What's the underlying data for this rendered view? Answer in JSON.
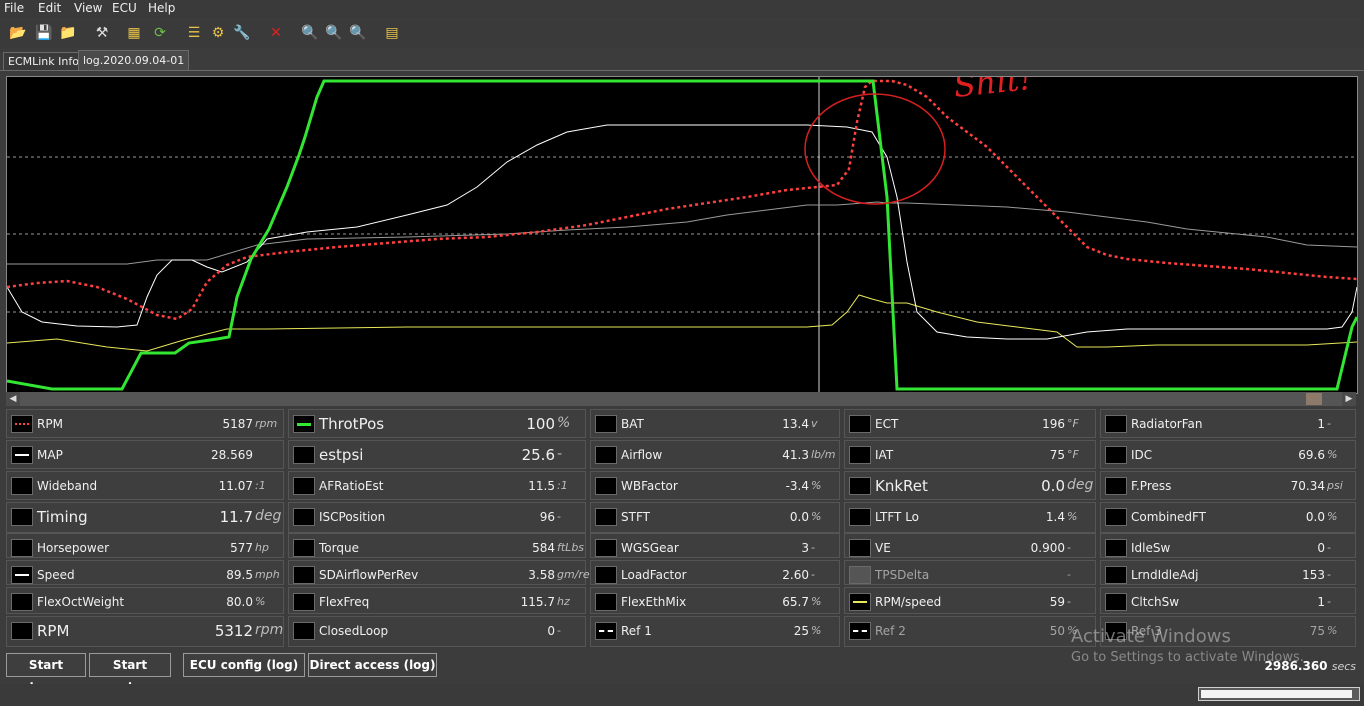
{
  "menu": [
    "File",
    "Edit",
    "View",
    "ECU",
    "Help"
  ],
  "toolbar_icons": [
    "open-folder-icon",
    "save-icon",
    "folder-icon",
    "tools-icon",
    "chart-settings-icon",
    "refresh-icon",
    "list-icon",
    "config-icon",
    "wrench-icon",
    "close-red-icon",
    "zoom-reset-icon",
    "zoom-in-icon",
    "zoom-out-icon",
    "report-icon"
  ],
  "tabs": [
    "ECMLink Info",
    "log.2020.09.04-01"
  ],
  "annotation_text": "Shit!",
  "colors": {
    "rpm": "#ff4040",
    "throttle": "#33e633",
    "map": "#ffffff",
    "speed": "#ffffff",
    "rpm_speed": "#e8e85a",
    "ref": "#ffffff",
    "background": "#000000"
  },
  "params": [
    [
      {
        "name": "RPM",
        "value": "5187",
        "unit": "rpm",
        "swatch": "red-dotted"
      },
      {
        "name": "MAP",
        "value": "28.569",
        "unit": "",
        "swatch": "white"
      },
      {
        "name": "Wideband",
        "value": "11.07",
        "unit": ":1"
      },
      {
        "name": "Timing",
        "value": "11.7",
        "unit": "deg",
        "big": true
      },
      {
        "name": "Horsepower",
        "value": "577",
        "unit": "hp"
      },
      {
        "name": "Speed",
        "value": "89.5",
        "unit": "mph",
        "swatch": "white"
      },
      {
        "name": "FlexOctWeight",
        "value": "80.0",
        "unit": "%"
      },
      {
        "name": "RPM",
        "value": "5312",
        "unit": "rpm",
        "big": true
      }
    ],
    [
      {
        "name": "ThrotPos",
        "value": "100",
        "unit": "%",
        "swatch": "green",
        "big": true
      },
      {
        "name": "estpsi",
        "value": "25.6",
        "unit": "-",
        "big": true
      },
      {
        "name": "AFRatioEst",
        "value": "11.5",
        "unit": ":1"
      },
      {
        "name": "ISCPosition",
        "value": "96",
        "unit": "-"
      },
      {
        "name": "Torque",
        "value": "584",
        "unit": "ftLbs"
      },
      {
        "name": "SDAirflowPerRev",
        "value": "3.58",
        "unit": "gm/rev"
      },
      {
        "name": "FlexFreq",
        "value": "115.7",
        "unit": "hz"
      },
      {
        "name": "ClosedLoop",
        "value": "0",
        "unit": "-"
      }
    ],
    [
      {
        "name": "BAT",
        "value": "13.4",
        "unit": "v"
      },
      {
        "name": "Airflow",
        "value": "41.3",
        "unit": "lb/m"
      },
      {
        "name": "WBFactor",
        "value": "-3.4",
        "unit": "%"
      },
      {
        "name": "STFT",
        "value": "0.0",
        "unit": "%"
      },
      {
        "name": "WGSGear",
        "value": "3",
        "unit": "-"
      },
      {
        "name": "LoadFactor",
        "value": "2.60",
        "unit": "-"
      },
      {
        "name": "FlexEthMix",
        "value": "65.7",
        "unit": "%"
      },
      {
        "name": "Ref 1",
        "value": "25",
        "unit": "%",
        "swatch": "white-dashed"
      }
    ],
    [
      {
        "name": "ECT",
        "value": "196",
        "unit": "°F"
      },
      {
        "name": "IAT",
        "value": "75",
        "unit": "°F"
      },
      {
        "name": "KnkRet",
        "value": "0.0",
        "unit": "deg",
        "big": true
      },
      {
        "name": "LTFT Lo",
        "value": "1.4",
        "unit": "%"
      },
      {
        "name": "VE",
        "value": "0.900",
        "unit": "-"
      },
      {
        "name": "TPSDelta",
        "value": "",
        "unit": "-",
        "dim": true,
        "swatch": "grey"
      },
      {
        "name": "RPM/speed",
        "value": "59",
        "unit": "-",
        "swatch": "yellow"
      },
      {
        "name": "Ref 2",
        "value": "50",
        "unit": "%",
        "swatch": "white-dashed",
        "dim": true
      }
    ],
    [
      {
        "name": "RadiatorFan",
        "value": "1",
        "unit": "-"
      },
      {
        "name": "IDC",
        "value": "69.6",
        "unit": "%"
      },
      {
        "name": "F.Press",
        "value": "70.34",
        "unit": "psi"
      },
      {
        "name": "CombinedFT",
        "value": "0.0",
        "unit": "%"
      },
      {
        "name": "IdleSw",
        "value": "0",
        "unit": "-"
      },
      {
        "name": "LrndIdleAdj",
        "value": "153",
        "unit": "-"
      },
      {
        "name": "CltchSw",
        "value": "1",
        "unit": "-"
      },
      {
        "name": "Ref 3",
        "value": "75",
        "unit": "%",
        "dim": true
      }
    ]
  ],
  "buttons": [
    "Start stream",
    "Start capture",
    "ECU config (log)",
    "Direct access (log)"
  ],
  "time_value": "2986.360",
  "time_unit": "secs",
  "watermark": {
    "line1": "Activate Windows",
    "line2": "Go to Settings to activate Windows."
  },
  "progress_fraction": 0.97
}
